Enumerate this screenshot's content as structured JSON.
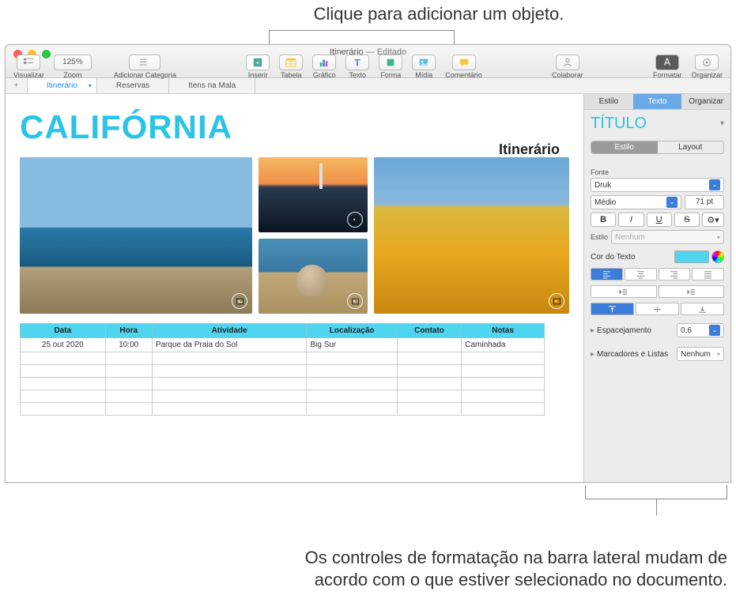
{
  "annotations": {
    "top": "Clique para adicionar um objeto.",
    "bottom": "Os controles de formatação na barra lateral mudam de acordo com o que estiver selecionado no documento."
  },
  "window": {
    "doc_name": "Itinerário",
    "doc_state": "Editado"
  },
  "toolbar": {
    "visualizar": "Visualizar",
    "zoom_value": "125%",
    "zoom_label": "Zoom",
    "adicionar_categoria": "Adicionar Categoria",
    "inserir": "Inserir",
    "tabela": "Tabela",
    "grafico": "Gráfico",
    "texto": "Texto",
    "forma": "Forma",
    "midia": "Mídia",
    "comentario": "Comentário",
    "colaborar": "Colaborar",
    "formatar": "Formatar",
    "organizar": "Organizar"
  },
  "sheets": {
    "items": [
      "Itinerário",
      "Reservas",
      "Itens na Mala"
    ],
    "active_index": 0
  },
  "document": {
    "title": "CALIFÓRNIA",
    "subtitle": "Itinerário",
    "table": {
      "headers": [
        "Data",
        "Hora",
        "Atividade",
        "Localização",
        "Contato",
        "Notas"
      ],
      "rows": [
        [
          "25 out 2020",
          "10:00",
          "Parque da Praia do Sol",
          "Big Sur",
          "",
          "Caminhada"
        ],
        [
          "",
          "",
          "",
          "",
          "",
          ""
        ],
        [
          "",
          "",
          "",
          "",
          "",
          ""
        ],
        [
          "",
          "",
          "",
          "",
          "",
          ""
        ],
        [
          "",
          "",
          "",
          "",
          "",
          ""
        ],
        [
          "",
          "",
          "",
          "",
          "",
          ""
        ]
      ]
    }
  },
  "inspector": {
    "tabs": [
      "Estilo",
      "Texto",
      "Organizar"
    ],
    "active_tab": 1,
    "title_style": "TÍTULO",
    "subtabs": [
      "Estilo",
      "Layout"
    ],
    "active_subtab": 0,
    "font_label": "Fonte",
    "font_family": "Druk",
    "font_weight": "Médio",
    "font_size": "71 pt",
    "char_style_label": "Estilo",
    "char_style_value": "Nenhum",
    "text_color_label": "Cor do Texto",
    "text_color": "#4fd5f0",
    "spacing_label": "Espacejamento",
    "spacing_value": "0,6",
    "bullets_label": "Marcadores e Listas",
    "bullets_value": "Nenhum",
    "gear_label": "⚙"
  }
}
